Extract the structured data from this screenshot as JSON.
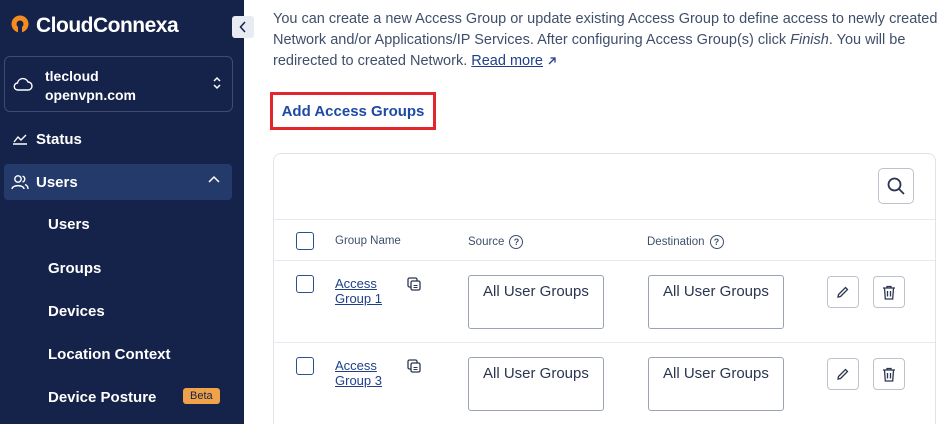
{
  "app": {
    "logo_text": "CloudConnexa"
  },
  "account": {
    "name": "tlecloud",
    "domain": "openvpn.com"
  },
  "sidebar": {
    "status_label": "Status",
    "users_label": "Users",
    "sub_items": [
      {
        "label": "Users"
      },
      {
        "label": "Groups"
      },
      {
        "label": "Devices"
      },
      {
        "label": "Location Context"
      },
      {
        "label": "Device Posture"
      }
    ],
    "beta_badge": "Beta"
  },
  "main": {
    "intro_part1": "You can create a new Access Group or update existing Access Group to define access to newly created Network and/or Applications/IP Services. After configuring Access Group(s) click ",
    "intro_finish": "Finish",
    "intro_part2": ". You will be redirected to created Network. ",
    "read_more": "Read more",
    "add_button": "Add Access Groups"
  },
  "table": {
    "headers": {
      "group_name": "Group Name",
      "source": "Source",
      "destination": "Destination"
    },
    "rows": [
      {
        "name": "Access Group 1",
        "source": "All User Groups",
        "destination": "All User Groups"
      },
      {
        "name": "Access Group 3",
        "source": "All User Groups",
        "destination": "All User Groups"
      }
    ]
  },
  "colors": {
    "sidebar_bg": "#15224a",
    "accent": "#1d4aa6",
    "highlight": "#e3262d",
    "beta": "#f0a24a"
  }
}
